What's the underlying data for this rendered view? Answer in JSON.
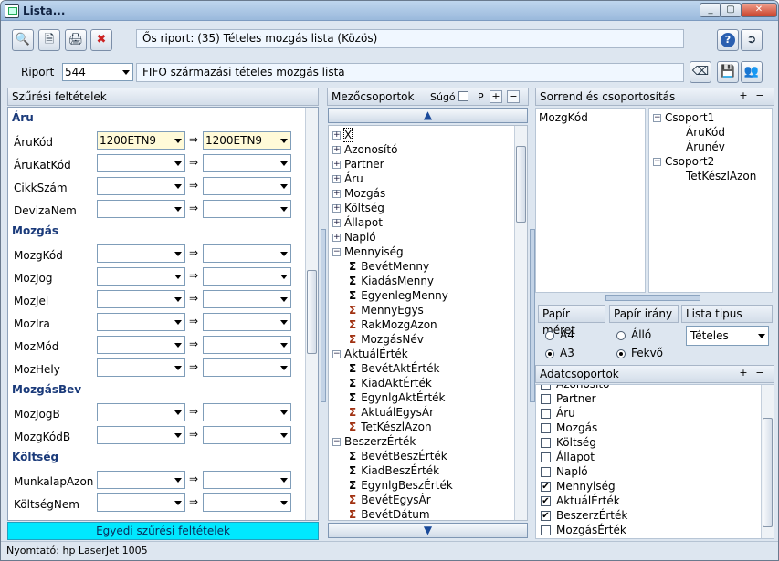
{
  "window": {
    "title": "Lista...",
    "controls": [
      "_",
      "▢",
      "✕"
    ]
  },
  "toolbar": {
    "riport_info": "Ős riport: (35)  Tételes mozgás lista (Közös)"
  },
  "riport": {
    "label": "Riport",
    "id": "544",
    "name": "FIFO származási tételes mozgás lista"
  },
  "filters": {
    "header": "Szűrési feltételek",
    "sections": [
      {
        "title": "Áru",
        "rows": [
          {
            "label": "ÁruKód",
            "from": "1200ETN9",
            "to": "1200ETN9"
          },
          {
            "label": "ÁruKatKód",
            "from": "",
            "to": ""
          },
          {
            "label": "CikkSzám",
            "from": "",
            "to": ""
          },
          {
            "label": "DevizaNem",
            "from": "",
            "to": ""
          }
        ]
      },
      {
        "title": "Mozgás",
        "rows": [
          {
            "label": "MozgKód",
            "from": "",
            "to": ""
          },
          {
            "label": "MozJog",
            "from": "",
            "to": ""
          },
          {
            "label": "MozJel",
            "from": "",
            "to": ""
          },
          {
            "label": "MozIra",
            "from": "",
            "to": ""
          },
          {
            "label": "MozMód",
            "from": "",
            "to": ""
          },
          {
            "label": "MozHely",
            "from": "",
            "to": ""
          }
        ]
      },
      {
        "title": "MozgásBev",
        "rows": [
          {
            "label": "MozJogB",
            "from": "",
            "to": ""
          },
          {
            "label": "MozgKódB",
            "from": "",
            "to": ""
          }
        ]
      },
      {
        "title": "Költség",
        "rows": [
          {
            "label": "MunkalapAzon",
            "from": "",
            "to": ""
          },
          {
            "label": "KöltségNem",
            "from": "",
            "to": ""
          }
        ]
      }
    ],
    "arrow": "⇒",
    "custom_button": "Egyedi szűrési feltételek"
  },
  "field_groups": {
    "header": "Mezőcsoportok",
    "help": "Súgó",
    "p_label": "P",
    "items": [
      {
        "text": "X",
        "kind": "plus",
        "level": 0,
        "selected": true
      },
      {
        "text": "Azonosító",
        "kind": "plus",
        "level": 0
      },
      {
        "text": "Partner",
        "kind": "plus",
        "level": 0
      },
      {
        "text": "Áru",
        "kind": "plus",
        "level": 0
      },
      {
        "text": "Mozgás",
        "kind": "plus",
        "level": 0
      },
      {
        "text": "Költség",
        "kind": "plus",
        "level": 0
      },
      {
        "text": "Állapot",
        "kind": "plus",
        "level": 0
      },
      {
        "text": "Napló",
        "kind": "plus",
        "level": 0
      },
      {
        "text": "Mennyiség",
        "kind": "minus",
        "level": 0
      },
      {
        "text": "BevétMenny",
        "kind": "sum",
        "level": 1
      },
      {
        "text": "KiadásMenny",
        "kind": "sum",
        "level": 1
      },
      {
        "text": "EgyenlegMenny",
        "kind": "sum",
        "level": 1
      },
      {
        "text": "MennyEgys",
        "kind": "sumr",
        "level": 1
      },
      {
        "text": "RakMozgAzon",
        "kind": "sumr",
        "level": 1
      },
      {
        "text": "MozgásNév",
        "kind": "sumr",
        "level": 1
      },
      {
        "text": "AktuálÉrték",
        "kind": "minus",
        "level": 0
      },
      {
        "text": "BevétAktÉrték",
        "kind": "sum",
        "level": 1
      },
      {
        "text": "KiadAktÉrték",
        "kind": "sum",
        "level": 1
      },
      {
        "text": "EgynlgAktÉrték",
        "kind": "sum",
        "level": 1
      },
      {
        "text": "AktuálEgysÁr",
        "kind": "sumr",
        "level": 1
      },
      {
        "text": "TetKészlAzon",
        "kind": "sumr",
        "level": 1
      },
      {
        "text": "BeszerzÉrték",
        "kind": "minus",
        "level": 0
      },
      {
        "text": "BevétBeszÉrték",
        "kind": "sum",
        "level": 1
      },
      {
        "text": "KiadBeszÉrték",
        "kind": "sum",
        "level": 1
      },
      {
        "text": "EgynlgBeszÉrték",
        "kind": "sum",
        "level": 1
      },
      {
        "text": "BevétEgysÁr",
        "kind": "sumr",
        "level": 1
      },
      {
        "text": "BevétDátum",
        "kind": "sumr",
        "level": 1
      }
    ]
  },
  "ordering": {
    "header": "Sorrend és csoportosítás",
    "left_item": "MozgKód",
    "groups": [
      {
        "text": "Csoport1",
        "level": 0
      },
      {
        "text": "ÁruKód",
        "level": 1
      },
      {
        "text": "Árunév",
        "level": 1
      },
      {
        "text": "Csoport2",
        "level": 0
      },
      {
        "text": "TetKészlAzon",
        "level": 1
      }
    ]
  },
  "paper": {
    "size_label": "Papír méret",
    "orient_label": "Papír irány",
    "type_label": "Lista tipus",
    "size_options": [
      {
        "text": "A4",
        "on": false
      },
      {
        "text": "A3",
        "on": true
      }
    ],
    "orient_options": [
      {
        "text": "Álló",
        "on": false
      },
      {
        "text": "Fekvő",
        "on": true
      }
    ],
    "type_value": "Tételes"
  },
  "data_groups": {
    "header": "Adatcsoportok",
    "partial": "Azonosító",
    "items": [
      {
        "text": "Partner",
        "checked": false
      },
      {
        "text": "Áru",
        "checked": false
      },
      {
        "text": "Mozgás",
        "checked": false
      },
      {
        "text": "Költség",
        "checked": false
      },
      {
        "text": "Állapot",
        "checked": false
      },
      {
        "text": "Napló",
        "checked": false
      },
      {
        "text": "Mennyiség",
        "checked": true
      },
      {
        "text": "AktuálÉrték",
        "checked": true
      },
      {
        "text": "BeszerzÉrték",
        "checked": true
      },
      {
        "text": "MozgásÉrték",
        "checked": false
      }
    ]
  },
  "status": {
    "printer": "Nyomtató: hp LaserJet 1005"
  }
}
